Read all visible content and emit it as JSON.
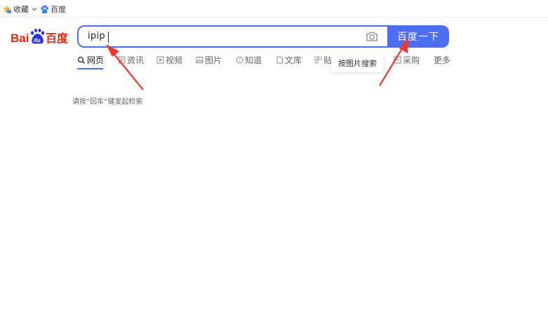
{
  "bookmarks": {
    "favorites_label": "收藏",
    "baidu_label": "百度"
  },
  "logo": {
    "text_bai": "Bai",
    "text_du": "du",
    "text_cn": "百度"
  },
  "search": {
    "value": "ipip",
    "button_label": "百度一下"
  },
  "tabs": [
    {
      "label": "网页",
      "icon": "search-icon"
    },
    {
      "label": "资讯",
      "icon": "news-icon"
    },
    {
      "label": "视频",
      "icon": "video-icon"
    },
    {
      "label": "图片",
      "icon": "image-icon"
    },
    {
      "label": "知道",
      "icon": "question-icon"
    },
    {
      "label": "文库",
      "icon": "doc-icon"
    },
    {
      "label": "贴",
      "icon": "tieba-icon"
    },
    {
      "label": "采购",
      "icon": "shop-icon"
    },
    {
      "label": "更多",
      "icon": ""
    }
  ],
  "tooltip": {
    "text": "按图片搜索"
  },
  "hint": {
    "text": "请按“回车”键发起检索"
  },
  "colors": {
    "accent": "#4e6ef2",
    "logo_red": "#de2910",
    "logo_blue": "#2932e1",
    "arrow": "#f0362e"
  }
}
